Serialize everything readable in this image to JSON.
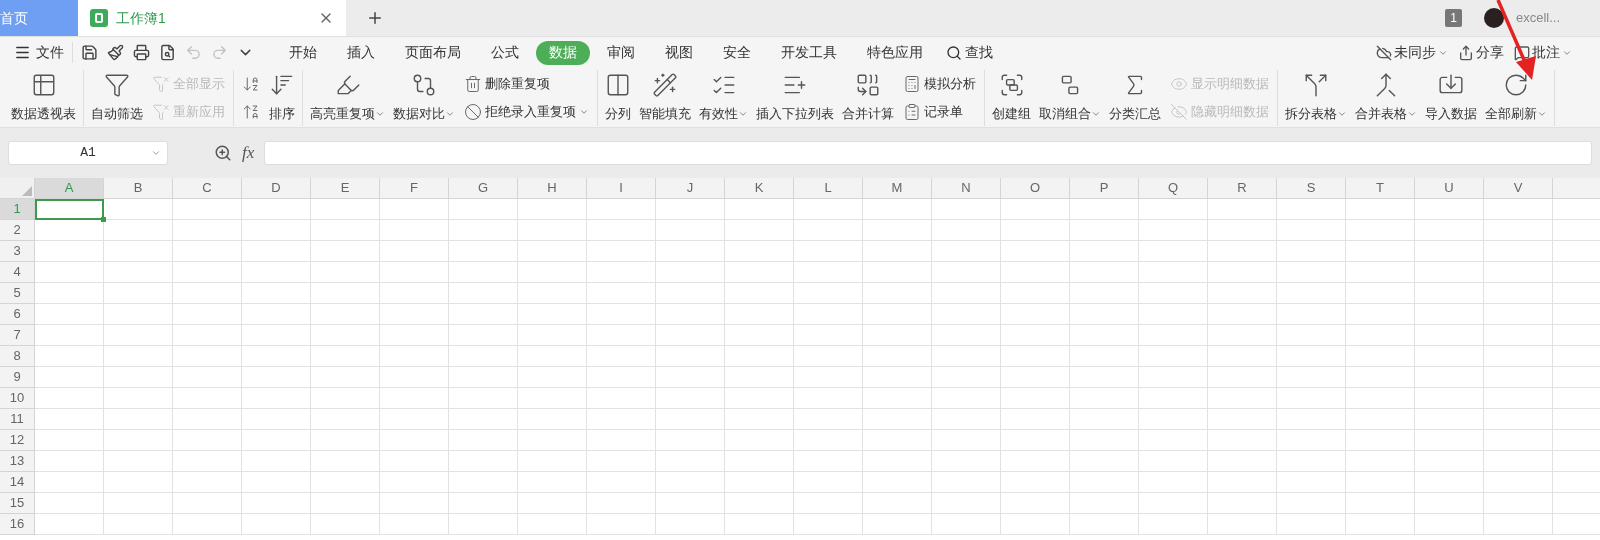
{
  "doc_tabs": [
    {
      "label": "首页",
      "kind": "home",
      "selected": false
    },
    {
      "label": "工作簿1",
      "kind": "sheet",
      "selected": true
    }
  ],
  "account": {
    "badge": "1",
    "name": "excell..."
  },
  "menu": {
    "file": "文件",
    "quick_tools": [
      {
        "disabled": false
      },
      {
        "disabled": false
      },
      {
        "disabled": false
      },
      {
        "disabled": false
      },
      {
        "disabled": true
      },
      {
        "disabled": true
      },
      {
        "disabled": false
      }
    ],
    "tabs": [
      {
        "label": "开始",
        "selected": false
      },
      {
        "label": "插入",
        "selected": false
      },
      {
        "label": "页面布局",
        "selected": false
      },
      {
        "label": "公式",
        "selected": false
      },
      {
        "label": "数据",
        "selected": true
      },
      {
        "label": "审阅",
        "selected": false
      },
      {
        "label": "视图",
        "selected": false
      },
      {
        "label": "安全",
        "selected": false
      },
      {
        "label": "开发工具",
        "selected": false
      },
      {
        "label": "特色应用",
        "selected": false
      }
    ],
    "search": "查找",
    "right": [
      {
        "label": "未同步",
        "dropdown": true
      },
      {
        "label": "分享",
        "dropdown": false
      },
      {
        "label": "批注",
        "dropdown": true
      }
    ]
  },
  "ribbon": [
    {
      "items": [
        {
          "kind": "big",
          "label": "数据透视表",
          "dropdown": false
        }
      ]
    },
    {
      "items": [
        {
          "kind": "big",
          "label": "自动筛选",
          "dropdown": false
        },
        {
          "kind": "stack",
          "items": [
            {
              "label": "全部显示",
              "disabled": true,
              "dropdown": false
            },
            {
              "label": "重新应用",
              "disabled": true,
              "dropdown": false
            }
          ]
        }
      ]
    },
    {
      "items": [
        {
          "kind": "stack",
          "items": [
            {
              "disabled": false,
              "dropdown": false
            },
            {
              "disabled": false,
              "dropdown": false
            }
          ]
        },
        {
          "kind": "big",
          "label": "排序",
          "dropdown": false
        }
      ]
    },
    {
      "items": [
        {
          "kind": "big",
          "label": "高亮重复项",
          "dropdown": true
        },
        {
          "kind": "big",
          "label": "数据对比",
          "dropdown": true
        },
        {
          "kind": "stack",
          "items": [
            {
              "label": "删除重复项",
              "disabled": false,
              "dropdown": false
            },
            {
              "label": "拒绝录入重复项",
              "disabled": false,
              "dropdown": true
            }
          ]
        }
      ]
    },
    {
      "items": [
        {
          "kind": "big",
          "label": "分列",
          "dropdown": false
        },
        {
          "kind": "big",
          "label": "智能填充",
          "dropdown": false
        },
        {
          "kind": "big",
          "label": "有效性",
          "dropdown": true
        },
        {
          "kind": "big",
          "label": "插入下拉列表",
          "dropdown": false
        },
        {
          "kind": "big",
          "label": "合并计算",
          "dropdown": false
        },
        {
          "kind": "stack",
          "items": [
            {
              "label": "模拟分析",
              "disabled": false,
              "dropdown": false
            },
            {
              "label": "记录单",
              "disabled": false,
              "dropdown": false
            }
          ]
        }
      ]
    },
    {
      "items": [
        {
          "kind": "big",
          "label": "创建组",
          "dropdown": false
        },
        {
          "kind": "big",
          "label": "取消组合",
          "dropdown": true
        },
        {
          "kind": "big",
          "label": "分类汇总",
          "dropdown": false
        },
        {
          "kind": "stack",
          "items": [
            {
              "label": "显示明细数据",
              "disabled": true,
              "dropdown": false
            },
            {
              "label": "隐藏明细数据",
              "disabled": true,
              "dropdown": false
            }
          ]
        }
      ]
    },
    {
      "items": [
        {
          "kind": "big",
          "label": "拆分表格",
          "dropdown": true
        },
        {
          "kind": "big",
          "label": "合并表格",
          "dropdown": true
        },
        {
          "kind": "big",
          "label": "导入数据",
          "dropdown": false
        },
        {
          "kind": "big",
          "label": "全部刷新",
          "dropdown": true
        }
      ]
    }
  ],
  "formula_bar": {
    "name_box": "A1",
    "fx": "fx"
  },
  "sheet": {
    "columns": [
      {
        "label": "A",
        "selected": true
      },
      {
        "label": "B",
        "selected": false
      },
      {
        "label": "C",
        "selected": false
      },
      {
        "label": "D",
        "selected": false
      },
      {
        "label": "E",
        "selected": false
      },
      {
        "label": "F",
        "selected": false
      },
      {
        "label": "G",
        "selected": false
      },
      {
        "label": "H",
        "selected": false
      },
      {
        "label": "I",
        "selected": false
      },
      {
        "label": "J",
        "selected": false
      },
      {
        "label": "K",
        "selected": false
      },
      {
        "label": "L",
        "selected": false
      },
      {
        "label": "M",
        "selected": false
      },
      {
        "label": "N",
        "selected": false
      },
      {
        "label": "O",
        "selected": false
      },
      {
        "label": "P",
        "selected": false
      },
      {
        "label": "Q",
        "selected": false
      },
      {
        "label": "R",
        "selected": false
      },
      {
        "label": "S",
        "selected": false
      },
      {
        "label": "T",
        "selected": false
      },
      {
        "label": "U",
        "selected": false
      },
      {
        "label": "V",
        "selected": false
      }
    ],
    "rows": [
      {
        "label": "1",
        "selected": true
      },
      {
        "label": "2",
        "selected": false
      },
      {
        "label": "3",
        "selected": false
      },
      {
        "label": "4",
        "selected": false
      },
      {
        "label": "5",
        "selected": false
      },
      {
        "label": "6",
        "selected": false
      },
      {
        "label": "7",
        "selected": false
      },
      {
        "label": "8",
        "selected": false
      },
      {
        "label": "9",
        "selected": false
      },
      {
        "label": "10",
        "selected": false
      },
      {
        "label": "11",
        "selected": false
      },
      {
        "label": "12",
        "selected": false
      },
      {
        "label": "13",
        "selected": false
      },
      {
        "label": "14",
        "selected": false
      },
      {
        "label": "15",
        "selected": false
      },
      {
        "label": "16",
        "selected": false
      }
    ]
  }
}
